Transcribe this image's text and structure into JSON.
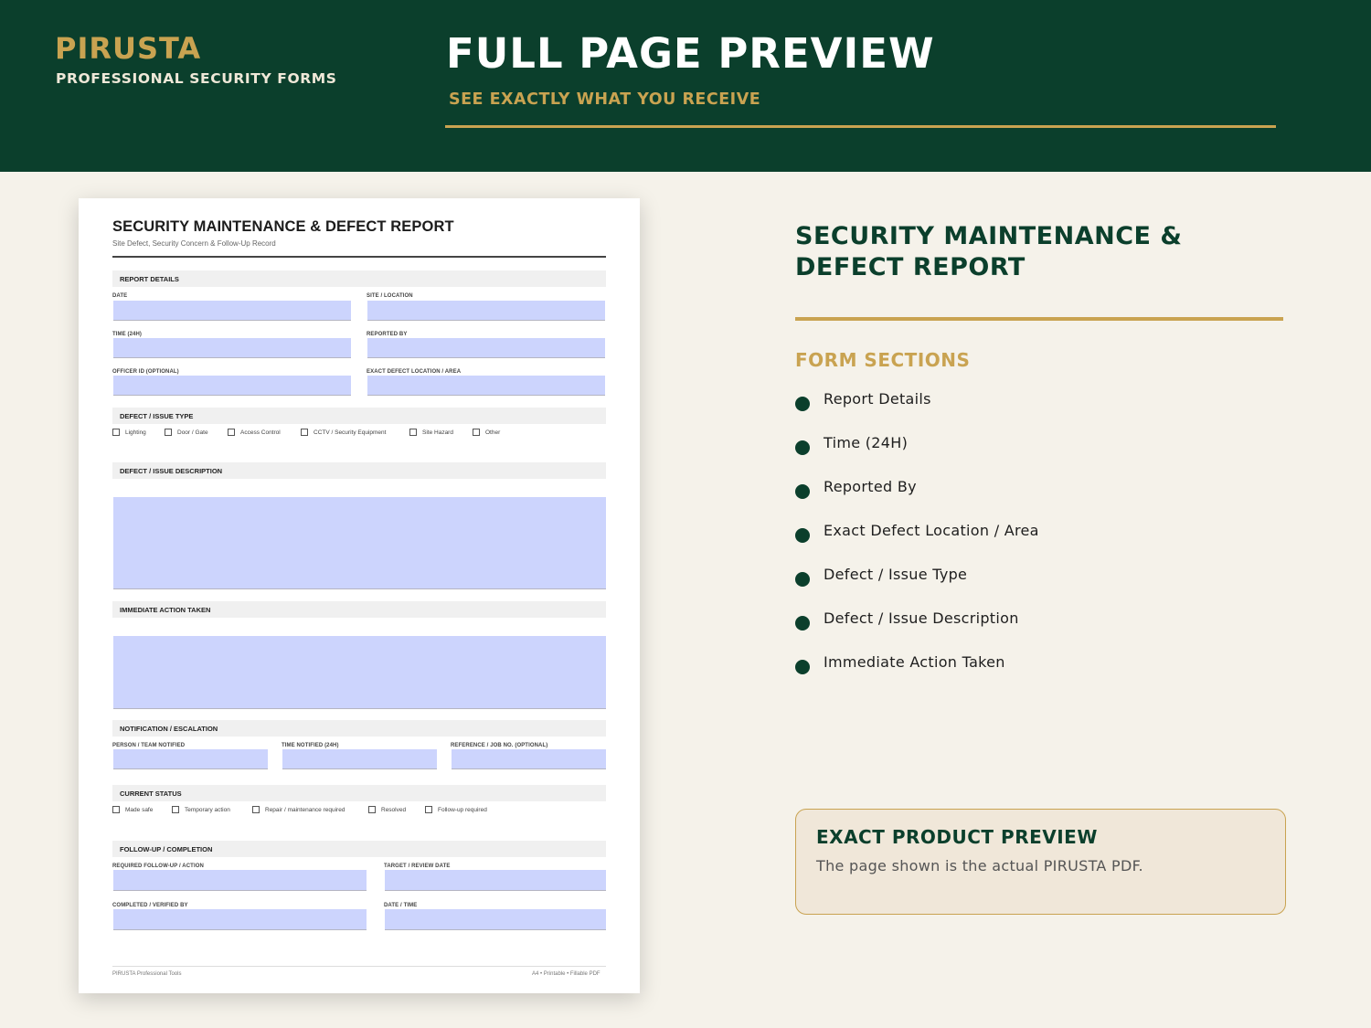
{
  "header": {
    "brand": "PIRUSTA",
    "brand_tagline": "PROFESSIONAL SECURITY FORMS",
    "title": "FULL PAGE PREVIEW",
    "subtitle": "SEE EXACTLY WHAT YOU RECEIVE"
  },
  "form": {
    "title": "SECURITY MAINTENANCE & DEFECT REPORT",
    "subtitle": "Site Defect, Security Concern & Follow-Up Record",
    "report_details": {
      "heading": "REPORT DETAILS",
      "date": "DATE",
      "site": "SITE / LOCATION",
      "time": "TIME (24H)",
      "reported_by": "REPORTED BY",
      "officer_id": "OFFICER ID (OPTIONAL)",
      "location": "EXACT DEFECT LOCATION / AREA"
    },
    "issue_type": {
      "heading": "DEFECT / ISSUE TYPE",
      "options": [
        "Lighting",
        "Door / Gate",
        "Access Control",
        "CCTV / Security Equipment",
        "Site Hazard",
        "Other"
      ]
    },
    "description": {
      "heading": "DEFECT / ISSUE DESCRIPTION"
    },
    "action": {
      "heading": "IMMEDIATE ACTION TAKEN"
    },
    "notification": {
      "heading": "NOTIFICATION / ESCALATION",
      "person": "PERSON / TEAM NOTIFIED",
      "time": "TIME NOTIFIED (24H)",
      "reference": "REFERENCE / JOB NO. (OPTIONAL)"
    },
    "status": {
      "heading": "CURRENT STATUS",
      "options": [
        "Made safe",
        "Temporary action",
        "Repair / maintenance required",
        "Resolved",
        "Follow-up required"
      ]
    },
    "followup": {
      "heading": "FOLLOW-UP / COMPLETION",
      "required": "REQUIRED FOLLOW-UP / ACTION",
      "target": "TARGET / REVIEW DATE",
      "completed": "COMPLETED / VERIFIED BY",
      "datetime": "DATE / TIME"
    },
    "footer_left": "PIRUSTA Professional Tools",
    "footer_right": "A4 • Printable • Fillable PDF"
  },
  "info": {
    "title": "SECURITY MAINTENANCE & DEFECT REPORT",
    "sections_heading": "FORM SECTIONS",
    "sections": [
      "Report Details",
      "Time (24H)",
      "Reported By",
      "Exact Defect Location / Area",
      "Defect / Issue Type",
      "Defect / Issue Description",
      "Immediate Action Taken"
    ],
    "callout_title": "EXACT PRODUCT PREVIEW",
    "callout_text": "The page shown is the actual PIRUSTA PDF."
  },
  "colors": {
    "brand_green": "#0b3f2c",
    "accent_gold": "#c9a351",
    "field_fill": "#ccd4fd",
    "page_bg": "#f5f2ea"
  }
}
